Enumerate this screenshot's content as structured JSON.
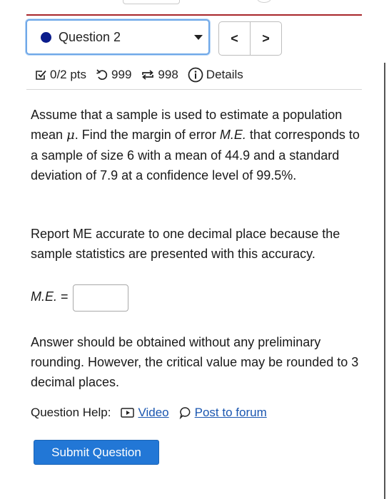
{
  "question_select": {
    "label": "Question 2"
  },
  "nav": {
    "prev": "<",
    "next": ">"
  },
  "meta": {
    "points": "0/2 pts",
    "attempts": "999",
    "retries": "998",
    "details": "Details"
  },
  "question": {
    "p1_a": "Assume that a sample is used to estimate a population mean ",
    "p1_mu": "μ",
    "p1_b": ". Find the margin of error ",
    "p1_me": "M.E.",
    "p1_c": " that corresponds to a sample of size 6 with a mean of 44.9 and a standard deviation of 7.9 at a confidence level of 99.5%.",
    "p2": "Report ME accurate to one decimal place because the sample statistics are presented with this accuracy.",
    "me_label": "M.E.",
    "me_equals": " =",
    "me_value": "",
    "p3": "Answer should be obtained without any preliminary rounding. However, the critical value may be rounded to 3 decimal places."
  },
  "help": {
    "label": "Question Help:",
    "video": "Video",
    "forum": "Post to forum"
  },
  "submit": "Submit Question",
  "colors": {
    "accent": "#2277d6",
    "rule": "#a8262a",
    "dot": "#0b1c8c",
    "link": "#1a56b0"
  }
}
